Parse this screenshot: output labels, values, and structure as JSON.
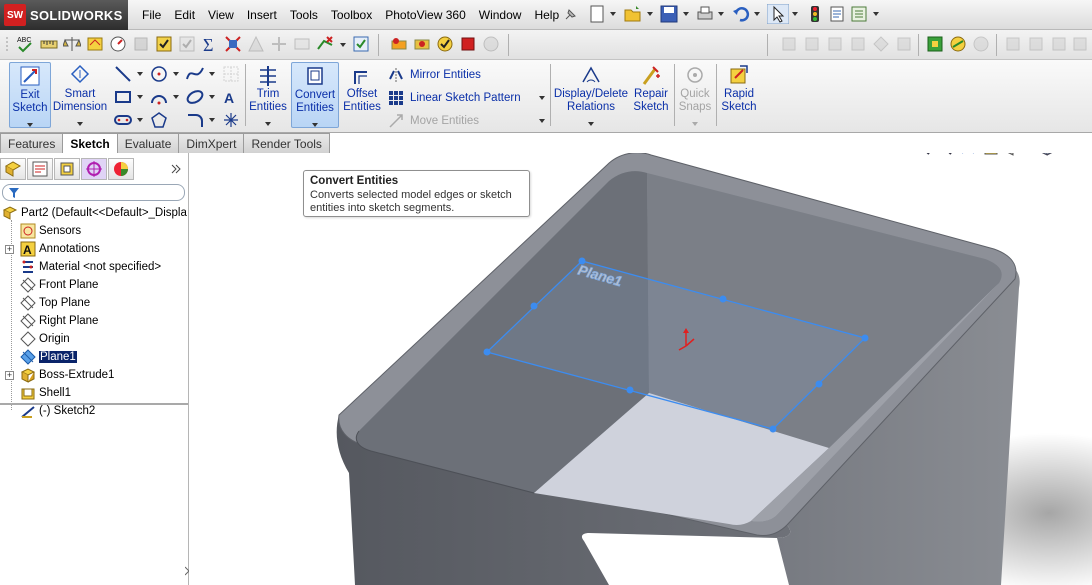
{
  "app": {
    "logo_text": "SOLIDWORKS",
    "logo_mark": "SW"
  },
  "menu": [
    "File",
    "Edit",
    "View",
    "Insert",
    "Tools",
    "Toolbox",
    "PhotoView 360",
    "Window",
    "Help"
  ],
  "command_manager": {
    "exit_sketch": "Exit\nSketch",
    "smart_dimension": "Smart\nDimension",
    "trim_entities": "Trim\nEntities",
    "convert_entities": "Convert\nEntities",
    "offset_entities": "Offset\nEntities",
    "mirror_entities": "Mirror Entities",
    "linear_sketch_pattern": "Linear Sketch Pattern",
    "move_entities": "Move Entities",
    "display_delete_relations": "Display/Delete\nRelations",
    "repair_sketch": "Repair\nSketch",
    "quick_snaps": "Quick\nSnaps",
    "rapid_sketch": "Rapid\nSketch"
  },
  "tabs": [
    {
      "label": "Features",
      "active": false
    },
    {
      "label": "Sketch",
      "active": true
    },
    {
      "label": "Evaluate",
      "active": false
    },
    {
      "label": "DimXpert",
      "active": false
    },
    {
      "label": "Render Tools",
      "active": false
    }
  ],
  "tooltip": {
    "title": "Convert Entities",
    "body": "Converts selected model edges or sketch entities into sketch segments."
  },
  "feature_tree": {
    "root": "Part2  (Default<<Default>_Displa",
    "items": [
      {
        "label": "Sensors",
        "icon": "sensor-icon",
        "selected": false
      },
      {
        "label": "Annotations",
        "icon": "annotations-icon",
        "selected": false
      },
      {
        "label": "Material <not specified>",
        "icon": "material-icon",
        "selected": false
      },
      {
        "label": "Front Plane",
        "icon": "plane-icon",
        "selected": false
      },
      {
        "label": "Top Plane",
        "icon": "plane-icon",
        "selected": false
      },
      {
        "label": "Right Plane",
        "icon": "plane-icon",
        "selected": false
      },
      {
        "label": "Origin",
        "icon": "origin-icon",
        "selected": false
      },
      {
        "label": "Plane1",
        "icon": "plane-icon",
        "selected": true
      },
      {
        "label": "Boss-Extrude1",
        "icon": "extrude-icon",
        "selected": false
      },
      {
        "label": "Shell1",
        "icon": "shell-icon",
        "selected": false
      },
      {
        "label": "(-) Sketch2",
        "icon": "sketch-icon",
        "selected": false
      }
    ]
  },
  "viewport": {
    "plane_label": "Plane1"
  },
  "colors": {
    "selection": "#0a246a",
    "command_text": "#0a2fa8",
    "sketch_blue": "#3c8cf0",
    "model_gray": "#7d8189"
  }
}
